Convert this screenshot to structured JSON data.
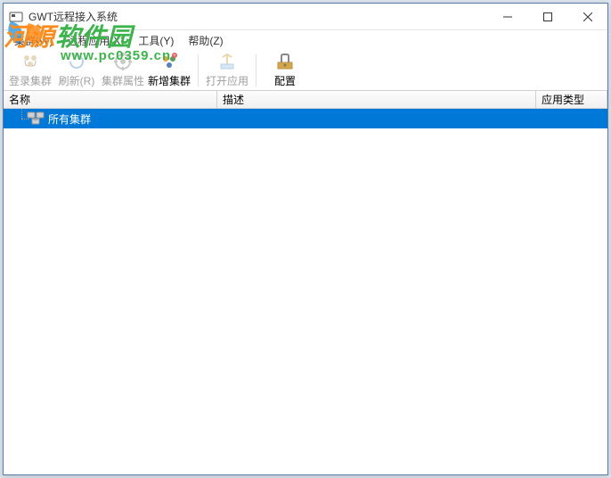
{
  "window": {
    "title": "GWT远程接入系统"
  },
  "menu": {
    "cluster": "集群(W)",
    "remote_app": "远程应用(X)",
    "tools": "工具(Y)",
    "help": "帮助(Z)"
  },
  "toolbar": {
    "login_cluster": "登录集群",
    "refresh": "刷新(R)",
    "cluster_props": "集群属性",
    "new_cluster": "新增集群",
    "open_app": "打开应用",
    "config": "配置"
  },
  "columns": {
    "name": "名称",
    "desc": "描述",
    "type": "应用类型"
  },
  "tree": {
    "all_clusters": "所有集群"
  },
  "watermark": {
    "brand_prefix": "河源",
    "brand_suffix": "软件园",
    "url": "www.pc0359.cn"
  }
}
